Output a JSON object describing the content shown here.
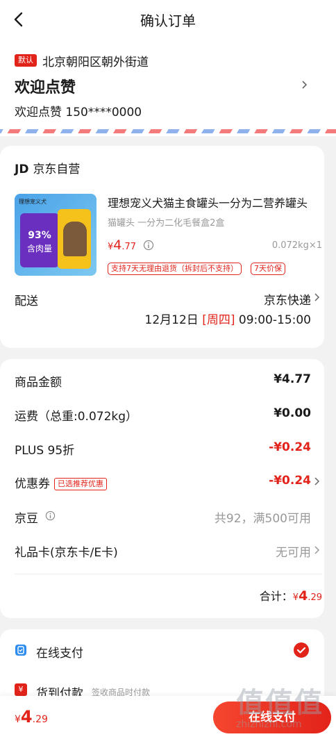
{
  "header": {
    "title": "确认订单"
  },
  "address": {
    "tag": "默认",
    "region": "北京朝阳区朝外街道",
    "name": "欢迎点赞",
    "contact": "欢迎点赞 150****0000"
  },
  "shop": {
    "logo": "JD",
    "name": "京东自营"
  },
  "product": {
    "thumb_brand": "理想宠义犬",
    "thumb_pct": "93%",
    "thumb_pct_label": "含肉量",
    "title": "理想宠义犬猫主食罐头一分为二营养罐头",
    "spec": "猫罐头 一分为二化毛餐盒2盒",
    "price_symbol": "¥",
    "price_int": "4",
    "price_dec": ".77",
    "qty": "0.072kg×1",
    "tags": [
      "支持7天无理由退货（拆封后不支持）",
      "7天价保"
    ]
  },
  "shipping": {
    "label": "配送",
    "method": "京东快递",
    "date_pre": "12月12日 ",
    "weekday": "[周四]",
    "time": " 09:00-15:00"
  },
  "summary": {
    "goods_label": "商品金额",
    "goods_value": "¥4.77",
    "freight_label": "运费（总重:0.072kg）",
    "freight_value": "¥0.00",
    "plus_label": "PLUS 95折",
    "plus_value": "-¥0.24",
    "coupon_label": "优惠券",
    "coupon_tag": "已选推荐优惠",
    "coupon_value": "-¥0.24",
    "jingdou_label": "京豆",
    "jingdou_value": "共92，满500可用",
    "gift_label": "礼品卡(京东卡/E卡)",
    "gift_value": "无可用",
    "total_label": "合计：",
    "total_symbol": "¥",
    "total_int": "4",
    "total_dec": ".29"
  },
  "payment": {
    "online_label": "在线支付",
    "cod_icon": "¥",
    "cod_label": "货到付款",
    "cod_sub": "签收商品时付款"
  },
  "bottom": {
    "price_symbol": "¥",
    "price_int": "4",
    "price_dec": ".29",
    "submit_label": "在线支付"
  },
  "watermark": {
    "chars": "值值值",
    "url": "zhizhizhi.com"
  },
  "colors": {
    "accent": "#e2231a",
    "muted": "#999999",
    "stripe_red": "#f47b7b",
    "stripe_blue": "#8fb2ec"
  }
}
